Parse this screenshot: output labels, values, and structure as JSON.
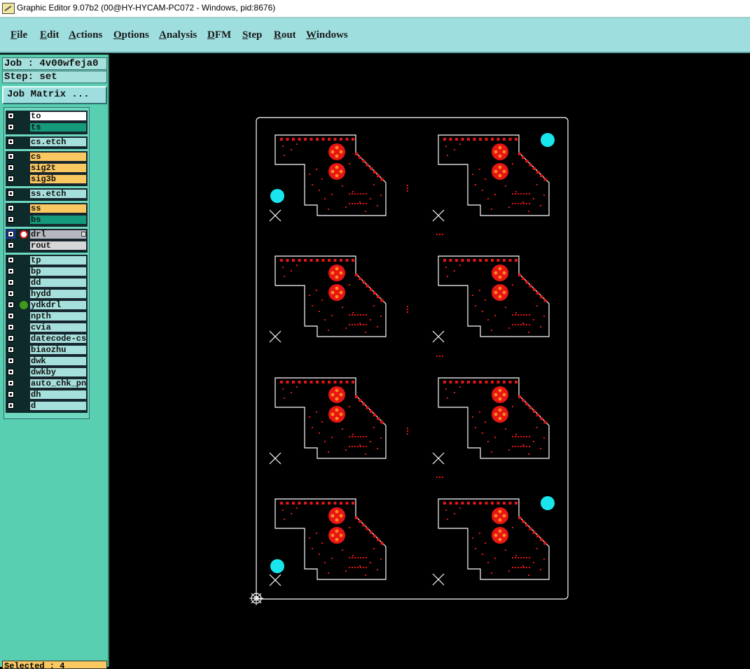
{
  "window": {
    "title": "Graphic Editor 9.07b2 (00@HY-HYCAM-PC072 - Windows, pid:8676)"
  },
  "menu": {
    "items": [
      {
        "mnemonic": "F",
        "rest": "ile"
      },
      {
        "mnemonic": "E",
        "rest": "dit"
      },
      {
        "mnemonic": "A",
        "rest": "ctions"
      },
      {
        "mnemonic": "O",
        "rest": "ptions"
      },
      {
        "mnemonic": "A",
        "rest": "nalysis"
      },
      {
        "mnemonic": "D",
        "rest": "FM"
      },
      {
        "mnemonic": "S",
        "rest": "tep"
      },
      {
        "mnemonic": "R",
        "rest": "out"
      },
      {
        "mnemonic": "W",
        "rest": "indows"
      }
    ]
  },
  "job": {
    "label": "Job : 4v00wfeja0",
    "step": "Step: set",
    "matrix_button": "Job Matrix ..."
  },
  "layers": [
    {
      "name": "to",
      "color": "#ffffff"
    },
    {
      "name": "ts",
      "color": "#139b7b"
    },
    {
      "name": "cs.etch",
      "color": "#a6e0dc"
    },
    {
      "name": "cs",
      "color": "#f9c861"
    },
    {
      "name": "sig2t",
      "color": "#f9c861"
    },
    {
      "name": "sig3b",
      "color": "#f9c861"
    },
    {
      "name": "ss.etch",
      "color": "#a6e0dc"
    },
    {
      "name": "ss",
      "color": "#f9c861"
    },
    {
      "name": "bs",
      "color": "#139b7b"
    },
    {
      "name": "drl",
      "color": "#b5b8bf",
      "active": "true"
    },
    {
      "name": "rout",
      "color": "#d7d7d7"
    },
    {
      "name": "tp",
      "color": "#a6e0dc"
    },
    {
      "name": "bp",
      "color": "#a6e0dc"
    },
    {
      "name": "dd",
      "color": "#a6e0dc"
    },
    {
      "name": "hydd",
      "color": "#a6e0dc"
    },
    {
      "name": "ydkdrl",
      "color": "#a6e0dc",
      "indicator": "green-dot"
    },
    {
      "name": "npth",
      "color": "#a6e0dc"
    },
    {
      "name": "cvia",
      "color": "#a6e0dc"
    },
    {
      "name": "datecode-cs",
      "color": "#a6e0dc"
    },
    {
      "name": "biaozhu",
      "color": "#a6e0dc"
    },
    {
      "name": "dwk",
      "color": "#a6e0dc"
    },
    {
      "name": "dwkby",
      "color": "#a6e0dc"
    },
    {
      "name": "auto_chk_pnl",
      "color": "#a6e0dc"
    },
    {
      "name": "dh",
      "color": "#a6e0dc"
    },
    {
      "name": "d",
      "color": "#a6e0dc"
    }
  ],
  "status": {
    "selected": "Selected : 4"
  },
  "colors": {
    "pad_red": "#e81515",
    "pad_orange": "#ff8a1e",
    "fiducial_cyan": "#19e6ec",
    "outline": "#ffffff"
  }
}
